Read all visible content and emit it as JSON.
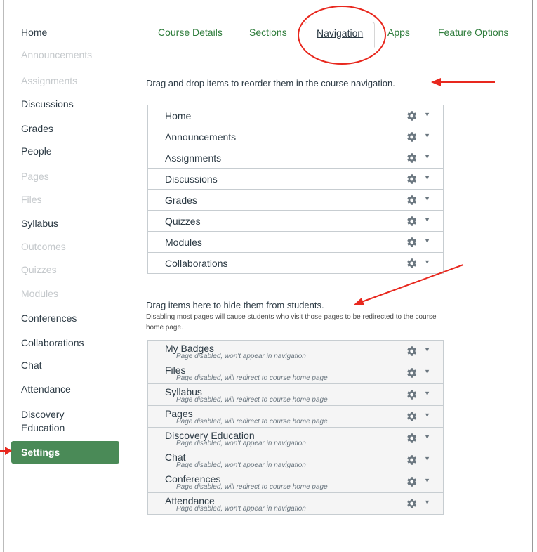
{
  "sidebar": {
    "items": [
      {
        "label": "Home",
        "dim": false
      },
      {
        "label": "Announcements",
        "dim": true
      },
      {
        "label": "Assignments",
        "dim": true
      },
      {
        "label": "Discussions",
        "dim": false
      },
      {
        "label": "Grades",
        "dim": false
      },
      {
        "label": "People",
        "dim": false
      },
      {
        "label": "Pages",
        "dim": true
      },
      {
        "label": "Files",
        "dim": true
      },
      {
        "label": "Syllabus",
        "dim": false
      },
      {
        "label": "Outcomes",
        "dim": true
      },
      {
        "label": "Quizzes",
        "dim": true
      },
      {
        "label": "Modules",
        "dim": true
      },
      {
        "label": "Conferences",
        "dim": false
      },
      {
        "label": "Collaborations",
        "dim": false
      },
      {
        "label": "Chat",
        "dim": false
      },
      {
        "label": "Attendance",
        "dim": false
      },
      {
        "label": "Discovery",
        "dim": false
      },
      {
        "label": "Education",
        "dim": false
      }
    ],
    "active": "Settings"
  },
  "tabs": {
    "course_details": "Course Details",
    "sections": "Sections",
    "navigation": "Navigation",
    "apps": "Apps",
    "feature_options": "Feature Options"
  },
  "enabled_instruction": "Drag and drop items to reorder them in the course navigation.",
  "enabled_items": [
    "Home",
    "Announcements",
    "Assignments",
    "Discussions",
    "Grades",
    "Quizzes",
    "Modules",
    "Collaborations"
  ],
  "hidden_instruction": "Drag items here to hide them from students.",
  "hidden_note": "Disabling most pages will cause students who visit those pages to be redirected to the course home page.",
  "disabled_items": [
    {
      "label": "My Badges",
      "sub": "Page disabled, won't appear in navigation"
    },
    {
      "label": "Files",
      "sub": "Page disabled, will redirect to course home page"
    },
    {
      "label": "Syllabus",
      "sub": "Page disabled, will redirect to course home page"
    },
    {
      "label": "Pages",
      "sub": "Page disabled, will redirect to course home page"
    },
    {
      "label": "Discovery Education",
      "sub": "Page disabled, won't appear in navigation"
    },
    {
      "label": "Chat",
      "sub": "Page disabled, won't appear in navigation"
    },
    {
      "label": "Conferences",
      "sub": "Page disabled, will redirect to course home page"
    },
    {
      "label": "Attendance",
      "sub": "Page disabled, won't appear in navigation"
    }
  ],
  "colors": {
    "accent_green": "#2f7d3c",
    "active_bg": "#4a8a57",
    "annotation_red": "#e8281e"
  },
  "icons": {
    "row_settings": "gear-icon",
    "row_menu": "caret-down-icon"
  }
}
